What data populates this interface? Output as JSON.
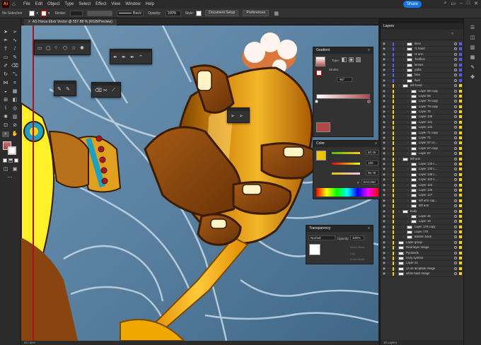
{
  "app": {
    "logo": "Ai",
    "share_label": "Share"
  },
  "menu": [
    "File",
    "Edit",
    "Object",
    "Type",
    "Select",
    "Effect",
    "View",
    "Window",
    "Help"
  ],
  "control": {
    "selection_label": "No Selection",
    "stroke_label": "Stroke:",
    "brush_label": "Basic",
    "opacity_label": "Opacity:",
    "opacity_value": "100%",
    "style_label": "Style:",
    "document_setup": "Document Setup",
    "preferences": "Preferences"
  },
  "document_tab": "AS Horus Elixir Vector @ 557.88 % (RGB/Preview)",
  "gradient": {
    "title": "Gradient",
    "type_label": "Type:",
    "stroke_label": "Stroke:",
    "angle_value": "-90°"
  },
  "color": {
    "title": "Color",
    "r_value": "50.16",
    "g_value": "100",
    "b_value": "96.78",
    "hex_value": "EAC460"
  },
  "transparency": {
    "title": "Transparency",
    "blend_mode": "Normal",
    "opacity_label": "Opacity:",
    "opacity_value": "100%",
    "make_mask": "Make Mask",
    "clip_label": "Clip",
    "invert_mask": "Invert Mask"
  },
  "layers": {
    "title": "Layers",
    "items": [
      {
        "name": "lines",
        "indent": 2,
        "color": "#5a5aff"
      },
      {
        "name": "r1 hand",
        "indent": 2,
        "color": "#5a5aff"
      },
      {
        "name": "r2 arm",
        "indent": 2,
        "color": "#5a5aff"
      },
      {
        "name": "Toolbox",
        "indent": 2,
        "color": "#5a5aff"
      },
      {
        "name": "lenses",
        "indent": 2,
        "color": "#5a5aff"
      },
      {
        "name": "yolks",
        "indent": 2,
        "color": "#5a5aff"
      },
      {
        "name": "face",
        "indent": 2,
        "color": "#5a5aff"
      },
      {
        "name": "fixel",
        "indent": 2,
        "color": "#5a5aff"
      },
      {
        "name": "left hand",
        "indent": 1,
        "color": "#ffd400"
      },
      {
        "name": "Layer 68 copy",
        "indent": 3,
        "color": "#ffd400"
      },
      {
        "name": "Layer 68",
        "indent": 3,
        "color": "#ffd400"
      },
      {
        "name": "Layer 70 copy",
        "indent": 3,
        "color": "#ffd400"
      },
      {
        "name": "Layer 79 copy",
        "indent": 3,
        "color": "#ffd400"
      },
      {
        "name": "Layer 76",
        "indent": 3,
        "color": "#ffd400"
      },
      {
        "name": "Layer 138",
        "indent": 3,
        "color": "#ffd400"
      },
      {
        "name": "Layer 121",
        "indent": 3,
        "color": "#ffd400"
      },
      {
        "name": "Layer 132",
        "indent": 3,
        "color": "#ffd400"
      },
      {
        "name": "Layer 71 copy",
        "indent": 3,
        "color": "#ffd400"
      },
      {
        "name": "Layer 71",
        "indent": 3,
        "color": "#ffd400"
      },
      {
        "name": "Layer 67 co...",
        "indent": 3,
        "color": "#ffd400"
      },
      {
        "name": "Layer 67 copy",
        "indent": 3,
        "color": "#ffd400"
      },
      {
        "name": "Layer 67",
        "indent": 3,
        "color": "#ffd400"
      },
      {
        "name": "left arm",
        "indent": 1,
        "color": "#ffd400"
      },
      {
        "name": "Layer 133 c...",
        "indent": 3,
        "color": "#ffd400"
      },
      {
        "name": "Layer 133 c...",
        "indent": 3,
        "color": "#ffd400"
      },
      {
        "name": "Layer 135 c...",
        "indent": 3,
        "color": "#ffd400"
      },
      {
        "name": "Layer 122 c...",
        "indent": 3,
        "color": "#ffd400"
      },
      {
        "name": "Layer 122",
        "indent": 3,
        "color": "#ffd400"
      },
      {
        "name": "Layer 126",
        "indent": 3,
        "color": "#ffd400"
      },
      {
        "name": "Layer 127",
        "indent": 3,
        "color": "#ffd400"
      },
      {
        "name": "left arm cop...",
        "indent": 3,
        "color": "#ffd400"
      },
      {
        "name": "left arm",
        "indent": 3,
        "color": "#ffd400"
      },
      {
        "name": "body",
        "indent": 1,
        "color": "#ffd400"
      },
      {
        "name": "Layer 46",
        "indent": 3,
        "color": "#ffd400"
      },
      {
        "name": "Layer 19",
        "indent": 3,
        "color": "#ffd400"
      },
      {
        "name": "Layer 176 copy",
        "indent": 2,
        "color": "#ffd400"
      },
      {
        "name": "Layer 170",
        "indent": 2,
        "color": "#ffd400"
      },
      {
        "name": "Bottom back",
        "indent": 2,
        "color": "#ffd400"
      },
      {
        "name": "Layer group",
        "indent": 0,
        "color": "#ffd400"
      },
      {
        "name": "Real layer Image",
        "indent": 0,
        "color": "#ffd400"
      },
      {
        "name": "Pyramids",
        "indent": 0,
        "color": "#ffd400"
      },
      {
        "name": "Ivory symbol",
        "indent": 0,
        "color": "#ffd400"
      },
      {
        "name": "Layer 21",
        "indent": 0,
        "color": "#ffd400"
      },
      {
        "name": "14 as template Image",
        "indent": 0,
        "color": "#ffd400"
      },
      {
        "name": "white back Image",
        "indent": 0,
        "color": "#ffd400"
      }
    ],
    "footer": "16 Layers"
  },
  "status": {
    "zoom": "557.88%"
  }
}
